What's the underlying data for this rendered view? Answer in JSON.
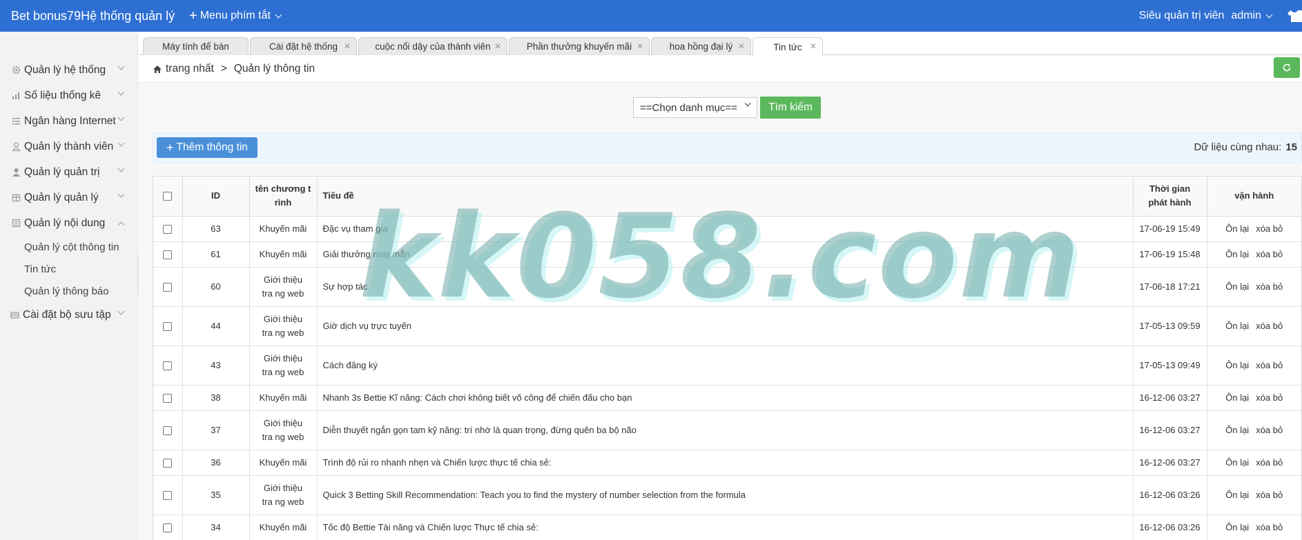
{
  "app": {
    "brand": "Bet bonus79Hệ thống quản lý",
    "shortcut_label": "Menu phím tắt",
    "role": "Siêu quản trị viên",
    "username": "admin",
    "accent_color": "#2e6fd3"
  },
  "sidebar": {
    "items": [
      {
        "label": "Quản lý hệ thống",
        "icon": "gear-icon"
      },
      {
        "label": "Số liệu thống kê",
        "icon": "bar-chart-icon"
      },
      {
        "label": "Ngân hàng Internet",
        "icon": "list-icon"
      },
      {
        "label": "Quản lý thành viên",
        "icon": "user-outline-icon"
      },
      {
        "label": "Quản lý quản trị",
        "icon": "user-icon"
      },
      {
        "label": "Quản lý quản lý",
        "icon": "grid-icon"
      },
      {
        "label": "Quản lý nội dung",
        "icon": "document-icon",
        "expanded": true
      },
      {
        "label": "Cài đặt bộ sưu tập",
        "icon": "folder-icon"
      }
    ],
    "subitems": [
      "Quản lý cột thông tin",
      "Tin tức",
      "Quản lý thông báo"
    ]
  },
  "tabs": [
    {
      "label": "Máy tính để bàn",
      "closable": false
    },
    {
      "label": "Cài đặt hệ thống",
      "closable": true
    },
    {
      "label": "cuộc nổi dậy của thành viên",
      "closable": true
    },
    {
      "label": "Phần thưởng khuyến mãi",
      "closable": true
    },
    {
      "label": "hoa hồng đại lý",
      "closable": true
    },
    {
      "label": "Tin tức",
      "closable": true,
      "active": true
    }
  ],
  "breadcrumb": {
    "home": "trang nhất",
    "separator": ">",
    "current": "Quản lý thông tin"
  },
  "filter": {
    "category_select": "==Chọn danh mục==",
    "search_label": "Tìm kiếm"
  },
  "toolbar": {
    "add_label": "Thêm thông tin",
    "total_label": "Dữ liệu cùng nhau:",
    "total_value": "15"
  },
  "table": {
    "columns": [
      "ID",
      "tên chương t rình",
      "Tiêu đề",
      "Thời gian phát hành",
      "vận hành"
    ],
    "rows": [
      {
        "id": "63",
        "program": "Khuyến mãi",
        "title": "Đặc vụ tham gia",
        "time": "17-06-19 15:49"
      },
      {
        "id": "61",
        "program": "Khuyến mãi",
        "title": "Giải thưởng may mắn",
        "time": "17-06-19 15:48"
      },
      {
        "id": "60",
        "program": "Giới thiệu tra ng web",
        "title": "Sự hợp tác",
        "time": "17-06-18 17:21"
      },
      {
        "id": "44",
        "program": "Giới thiệu tra ng web",
        "title": "Giờ dịch vụ trực tuyến",
        "time": "17-05-13 09:59"
      },
      {
        "id": "43",
        "program": "Giới thiệu tra ng web",
        "title": "Cách đăng ký",
        "time": "17-05-13 09:49"
      },
      {
        "id": "38",
        "program": "Khuyến mãi",
        "title": "Nhanh 3s Bettie Kĩ năng: Cách chơi không biết võ công để chiến đấu cho bạn",
        "time": "16-12-06 03:27"
      },
      {
        "id": "37",
        "program": "Giới thiệu tra ng web",
        "title": "Diễn thuyết ngắn gọn tam kỹ năng: trí nhớ là quan trọng, đừng quên ba bộ não",
        "time": "16-12-06 03:27"
      },
      {
        "id": "36",
        "program": "Khuyến mãi",
        "title": "Trình độ rủi ro nhanh nhẹn và Chiến lược thực tế chia sẻ:",
        "time": "16-12-06 03:27"
      },
      {
        "id": "35",
        "program": "Giới thiệu tra ng web",
        "title": "Quick 3 Betting Skill Recommendation: Teach you to find the mystery of number selection from the formula",
        "time": "16-12-06 03:26"
      },
      {
        "id": "34",
        "program": "Khuyến mãi",
        "title": "Tốc độ Bettie Tài năng và Chiến lược Thực tế chia sẻ:",
        "time": "16-12-06 03:26"
      }
    ],
    "actions": {
      "edit": "Ôn lại",
      "delete": "xóa bỏ"
    }
  },
  "watermark": "kk058.com"
}
